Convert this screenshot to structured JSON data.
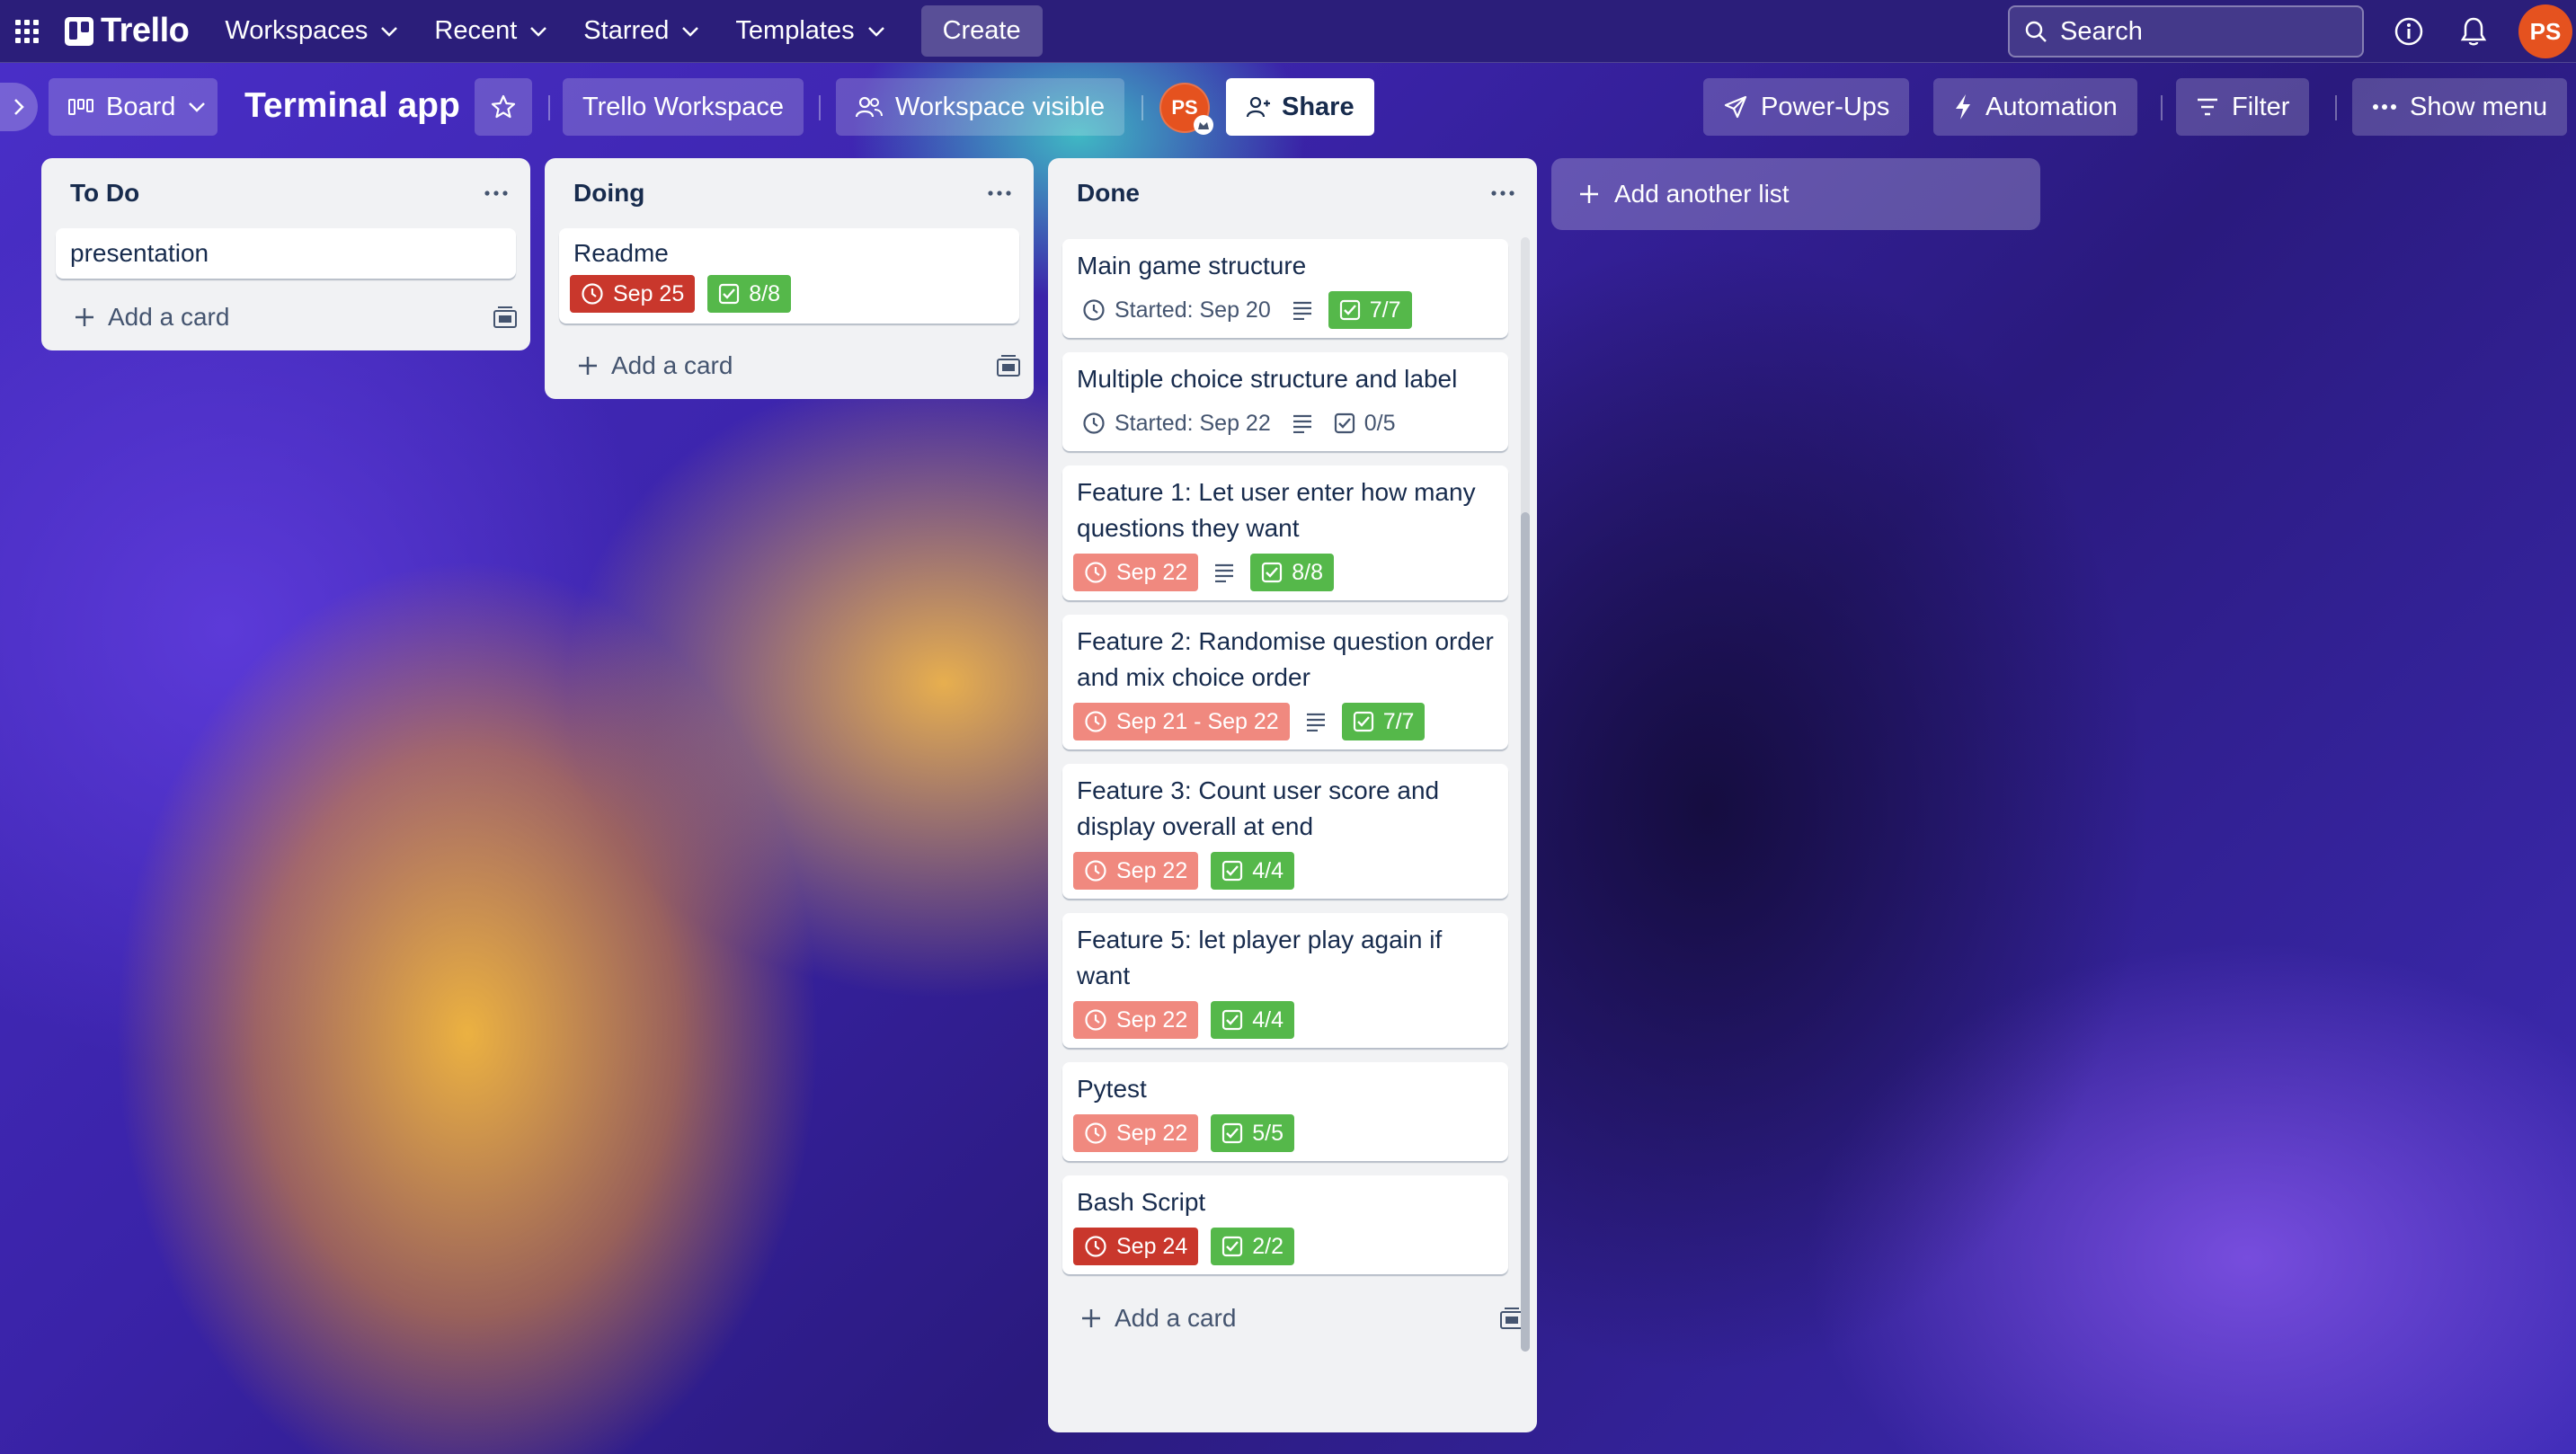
{
  "topnav": {
    "app_name": "Trello",
    "menu": [
      {
        "label": "Workspaces"
      },
      {
        "label": "Recent"
      },
      {
        "label": "Starred"
      },
      {
        "label": "Templates"
      }
    ],
    "create_label": "Create",
    "search_placeholder": "Search",
    "user_initials": "PS"
  },
  "board": {
    "view_label": "Board",
    "title": "Terminal app",
    "workspace_label": "Trello Workspace",
    "visibility_label": "Workspace visible",
    "member_initials": "PS",
    "share_label": "Share",
    "powerups_label": "Power-Ups",
    "automation_label": "Automation",
    "filter_label": "Filter",
    "show_menu_label": "Show menu",
    "add_list_label": "Add another list"
  },
  "lists": [
    {
      "title": "To Do",
      "add_card_label": "Add a card",
      "cards": [
        {
          "title": "presentation"
        }
      ]
    },
    {
      "title": "Doing",
      "add_card_label": "Add a card",
      "cards": [
        {
          "title": "Readme",
          "date": "Sep 25",
          "checklist": "8/8"
        }
      ]
    },
    {
      "title": "Done",
      "add_card_label": "Add a card",
      "cards": [
        {
          "title": "Main game structure",
          "date": "Started: Sep 20",
          "checklist": "7/7"
        },
        {
          "title": "Multiple choice structure and label",
          "date": "Started: Sep 22",
          "checklist": "0/5"
        },
        {
          "title": "Feature 1: Let user enter how many questions they want",
          "date": "Sep 22",
          "checklist": "8/8"
        },
        {
          "title": "Feature 2: Randomise question order and mix choice order",
          "date": "Sep 21 - Sep 22",
          "checklist": "7/7"
        },
        {
          "title": "Feature 3: Count user score and display overall at end",
          "date": "Sep 22",
          "checklist": "4/4"
        },
        {
          "title": "Feature 5: let player play again if want",
          "date": "Sep 22",
          "checklist": "4/4"
        },
        {
          "title": "Pytest",
          "date": "Sep 22",
          "checklist": "5/5"
        },
        {
          "title": "Bash Script",
          "date": "Sep 24",
          "checklist": "2/2"
        }
      ]
    }
  ],
  "colors": {
    "nav_bg": "#2b1e7a",
    "list_bg": "#f1f2f4",
    "due_overdue": "#c9372c",
    "due_past": "#f0897f",
    "checklist_complete": "#55b84a",
    "avatar": "#e5521f"
  },
  "icons": [
    "apps-grid-icon",
    "trello-logo-icon",
    "chevron-down-icon",
    "search-icon",
    "info-icon",
    "bell-icon",
    "chevron-right-icon",
    "board-view-icon",
    "star-icon",
    "people-icon",
    "share-person-icon",
    "rocket-icon",
    "lightning-icon",
    "filter-icon",
    "more-icon",
    "clock-icon",
    "description-icon",
    "checklist-icon",
    "plus-icon",
    "template-icon"
  ]
}
